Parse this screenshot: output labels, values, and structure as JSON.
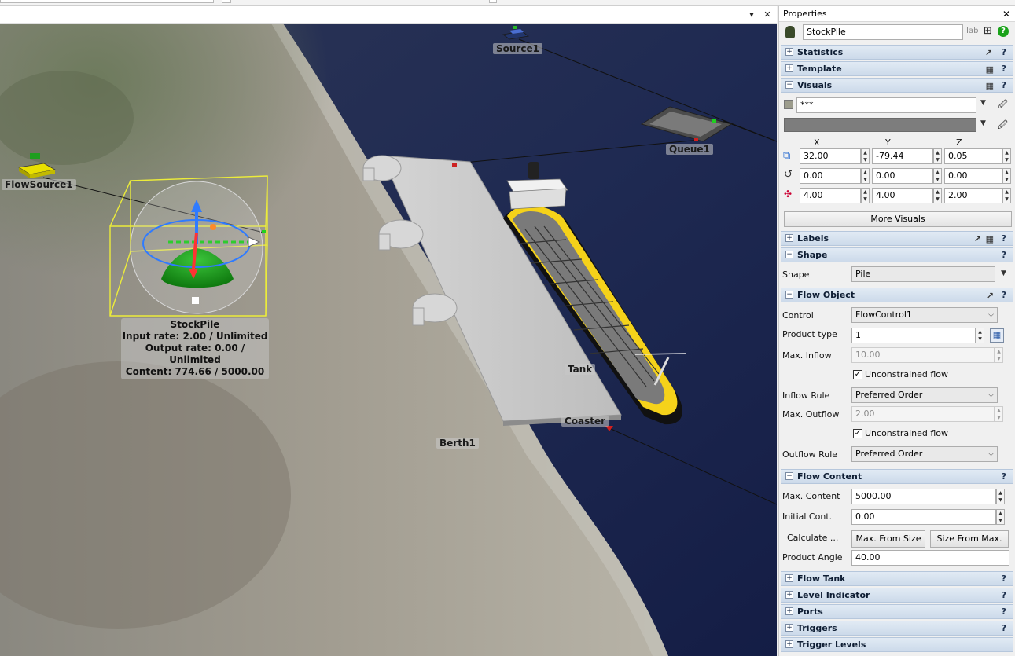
{
  "viewport": {
    "pin_glyph": "▾",
    "close_glyph": "✕",
    "labels": {
      "source": "Source1",
      "queue": "Queue1",
      "flowsource": "FlowSource1",
      "stockpile": "StockPile",
      "tank": "Tank",
      "coaster": "Coaster",
      "berth": "Berth1"
    },
    "stockpile_stats": {
      "input": "Input rate: 2.00 / Unlimited",
      "output": "Output rate: 0.00 / Unlimited",
      "content": "Content: 774.66 / 5000.00"
    }
  },
  "panel": {
    "title": "Properties",
    "object_name": "StockPile",
    "sections": {
      "statistics": "Statistics",
      "template": "Template",
      "visuals": "Visuals",
      "labels": "Labels",
      "shape": "Shape",
      "flow_object": "Flow Object",
      "flow_content": "Flow Content",
      "flow_tank": "Flow Tank",
      "level_indicator": "Level Indicator",
      "ports": "Ports",
      "triggers": "Triggers",
      "trigger_levels": "Trigger Levels"
    },
    "visuals": {
      "color_value": "***",
      "x_header": "X",
      "y_header": "Y",
      "z_header": "Z",
      "pos": [
        "32.00",
        "-79.44",
        "0.05"
      ],
      "rot": [
        "0.00",
        "0.00",
        "0.00"
      ],
      "size": [
        "4.00",
        "4.00",
        "2.00"
      ],
      "more_visuals": "More Visuals"
    },
    "shape": {
      "label": "Shape",
      "value": "Pile"
    },
    "flow_object": {
      "control_label": "Control",
      "control_value": "FlowControl1",
      "product_type_label": "Product type",
      "product_type_value": "1",
      "max_inflow_label": "Max. Inflow",
      "max_inflow_value": "10.00",
      "unconstrained_label": "Unconstrained flow",
      "inflow_rule_label": "Inflow Rule",
      "inflow_rule_value": "Preferred Order",
      "max_outflow_label": "Max. Outflow",
      "max_outflow_value": "2.00",
      "outflow_rule_label": "Outflow Rule",
      "outflow_rule_value": "Preferred Order"
    },
    "flow_content": {
      "max_content_label": "Max. Content",
      "max_content_value": "5000.00",
      "initial_label": "Initial Cont.",
      "initial_value": "0.00",
      "calculate_label": "Calculate ...",
      "max_from_size": "Max. From Size",
      "size_from_max": "Size From Max.",
      "angle_label": "Product Angle",
      "angle_value": "40.00"
    },
    "colors": {
      "section_header": "#ccdaea",
      "accent_green": "#1aa31a"
    }
  }
}
